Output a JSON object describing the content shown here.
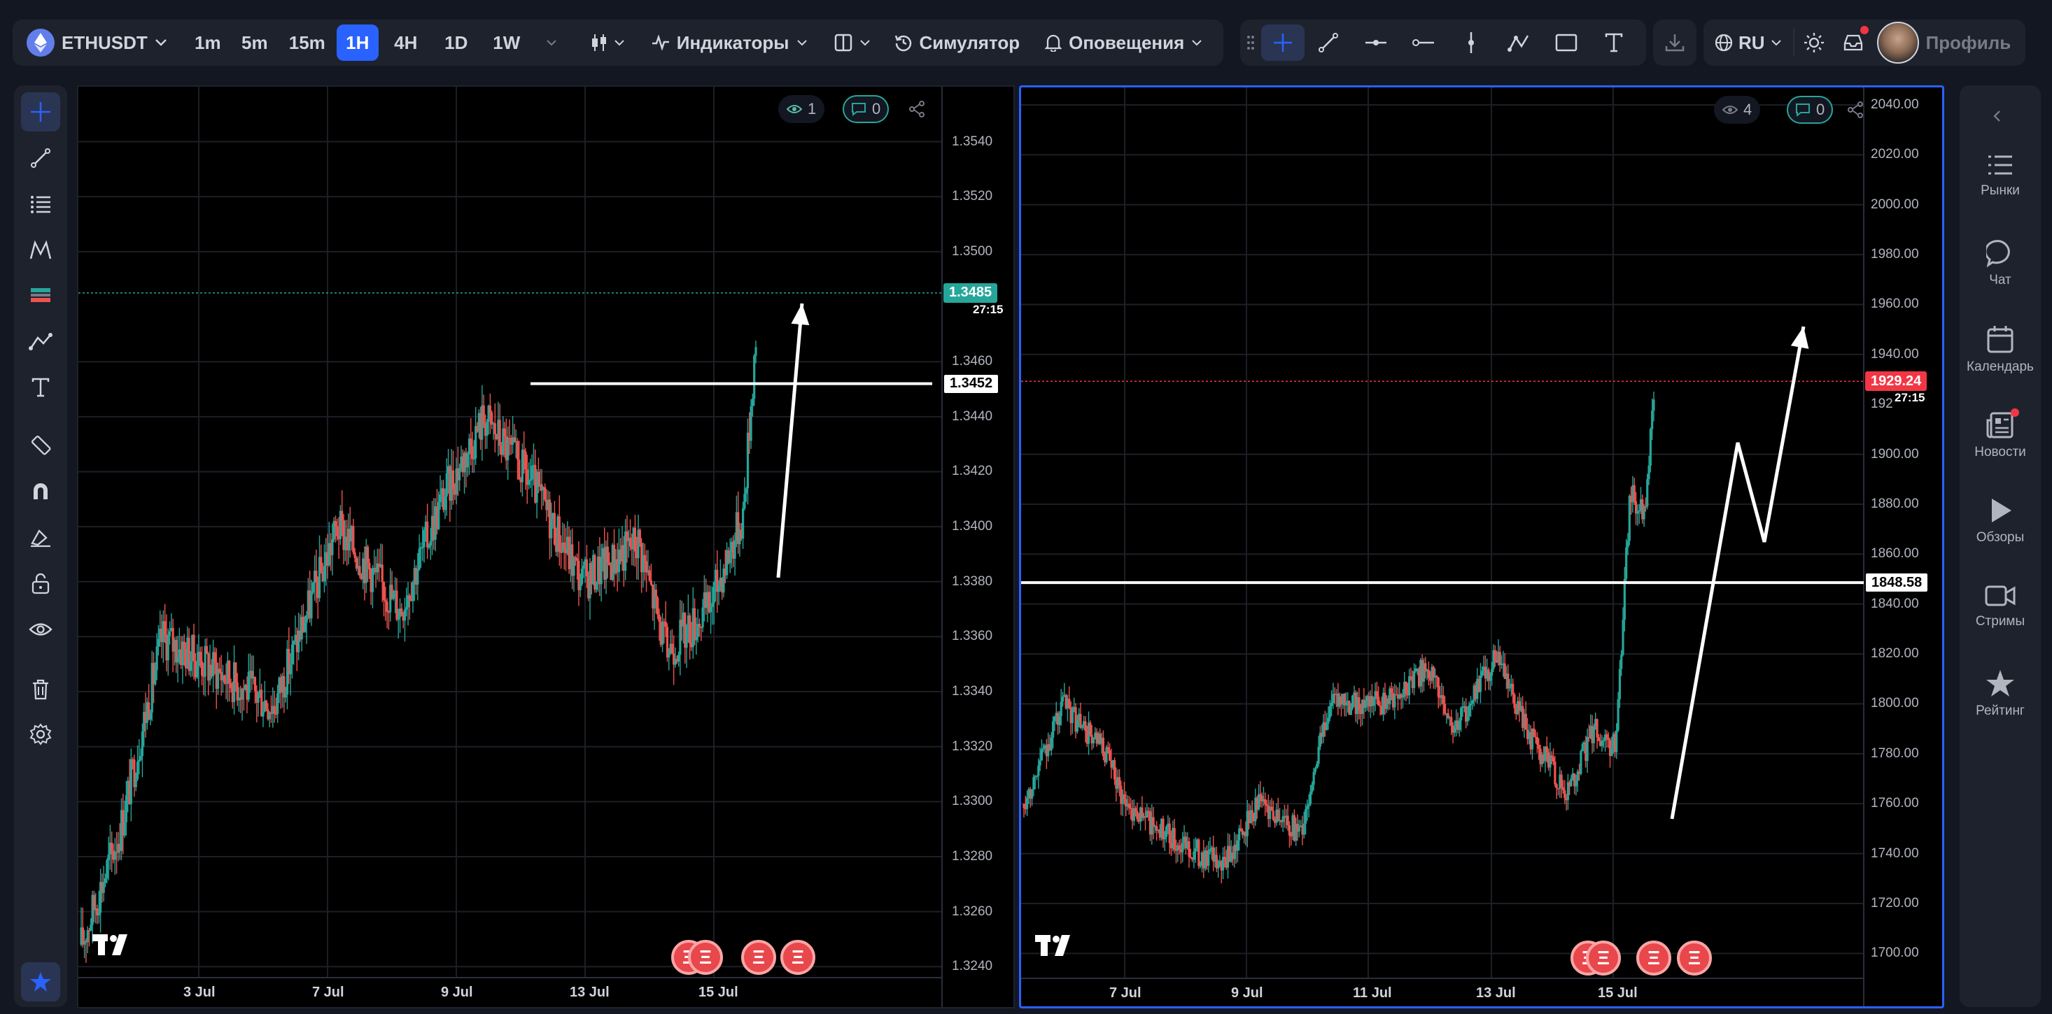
{
  "topbar": {
    "symbol": "ETHUSDT",
    "timeframes": [
      "1m",
      "5m",
      "15m",
      "1H",
      "4H",
      "1D",
      "1W"
    ],
    "active_timeframe": "1H",
    "indicators_label": "Индикаторы",
    "simulator_label": "Симулятор",
    "alerts_label": "Оповещения",
    "language": "RU",
    "profile_label": "Профиль"
  },
  "right_sidebar": {
    "items": [
      {
        "label": "Рынки",
        "icon": "list-icon"
      },
      {
        "label": "Чат",
        "icon": "chat-icon"
      },
      {
        "label": "Календарь",
        "icon": "calendar-icon"
      },
      {
        "label": "Новости",
        "icon": "news-icon"
      },
      {
        "label": "Обзоры",
        "icon": "play-icon"
      },
      {
        "label": "Стримы",
        "icon": "video-icon"
      },
      {
        "label": "Рейтинг",
        "icon": "star-icon"
      }
    ]
  },
  "left_chart": {
    "views_count": "1",
    "comments_count": "0",
    "price_labels": [
      "1.3540",
      "1.3520",
      "1.3500",
      "1.3460",
      "1.3440",
      "1.3420",
      "1.3400",
      "1.3380",
      "1.3360",
      "1.3340",
      "1.3320",
      "1.3300",
      "1.3280",
      "1.3260",
      "1.3240"
    ],
    "current_price": "1.3485",
    "countdown": "27:15",
    "level_price": "1.3452",
    "date_labels": [
      "3 Jul",
      "7 Jul",
      "9 Jul",
      "13 Jul",
      "15 Jul"
    ],
    "price_min": 1.3236,
    "price_max": 1.356,
    "current_price_value": 1.3485,
    "level_value": 1.3452
  },
  "right_chart": {
    "views_count": "4",
    "comments_count": "0",
    "price_labels": [
      "2040.00",
      "2020.00",
      "2000.00",
      "1980.00",
      "1960.00",
      "1940.00",
      "1900.00",
      "1880.00",
      "1860.00",
      "1840.00",
      "1820.00",
      "1800.00",
      "1780.00",
      "1760.00",
      "1740.00",
      "1720.00",
      "1700.00"
    ],
    "current_price": "1929.24",
    "partial_label": "192",
    "countdown": "27:15",
    "level_price": "1848.58",
    "date_labels": [
      "7 Jul",
      "9 Jul",
      "11 Jul",
      "13 Jul",
      "15 Jul"
    ],
    "price_min": 1690,
    "price_max": 2047,
    "current_price_value": 1929.24,
    "level_value": 1848.58
  },
  "colors": {
    "up": "#26a69a",
    "down": "#ef5350",
    "accent": "#2962ff",
    "current_price_left": "#26a69a",
    "current_price_right": "#f23645"
  }
}
